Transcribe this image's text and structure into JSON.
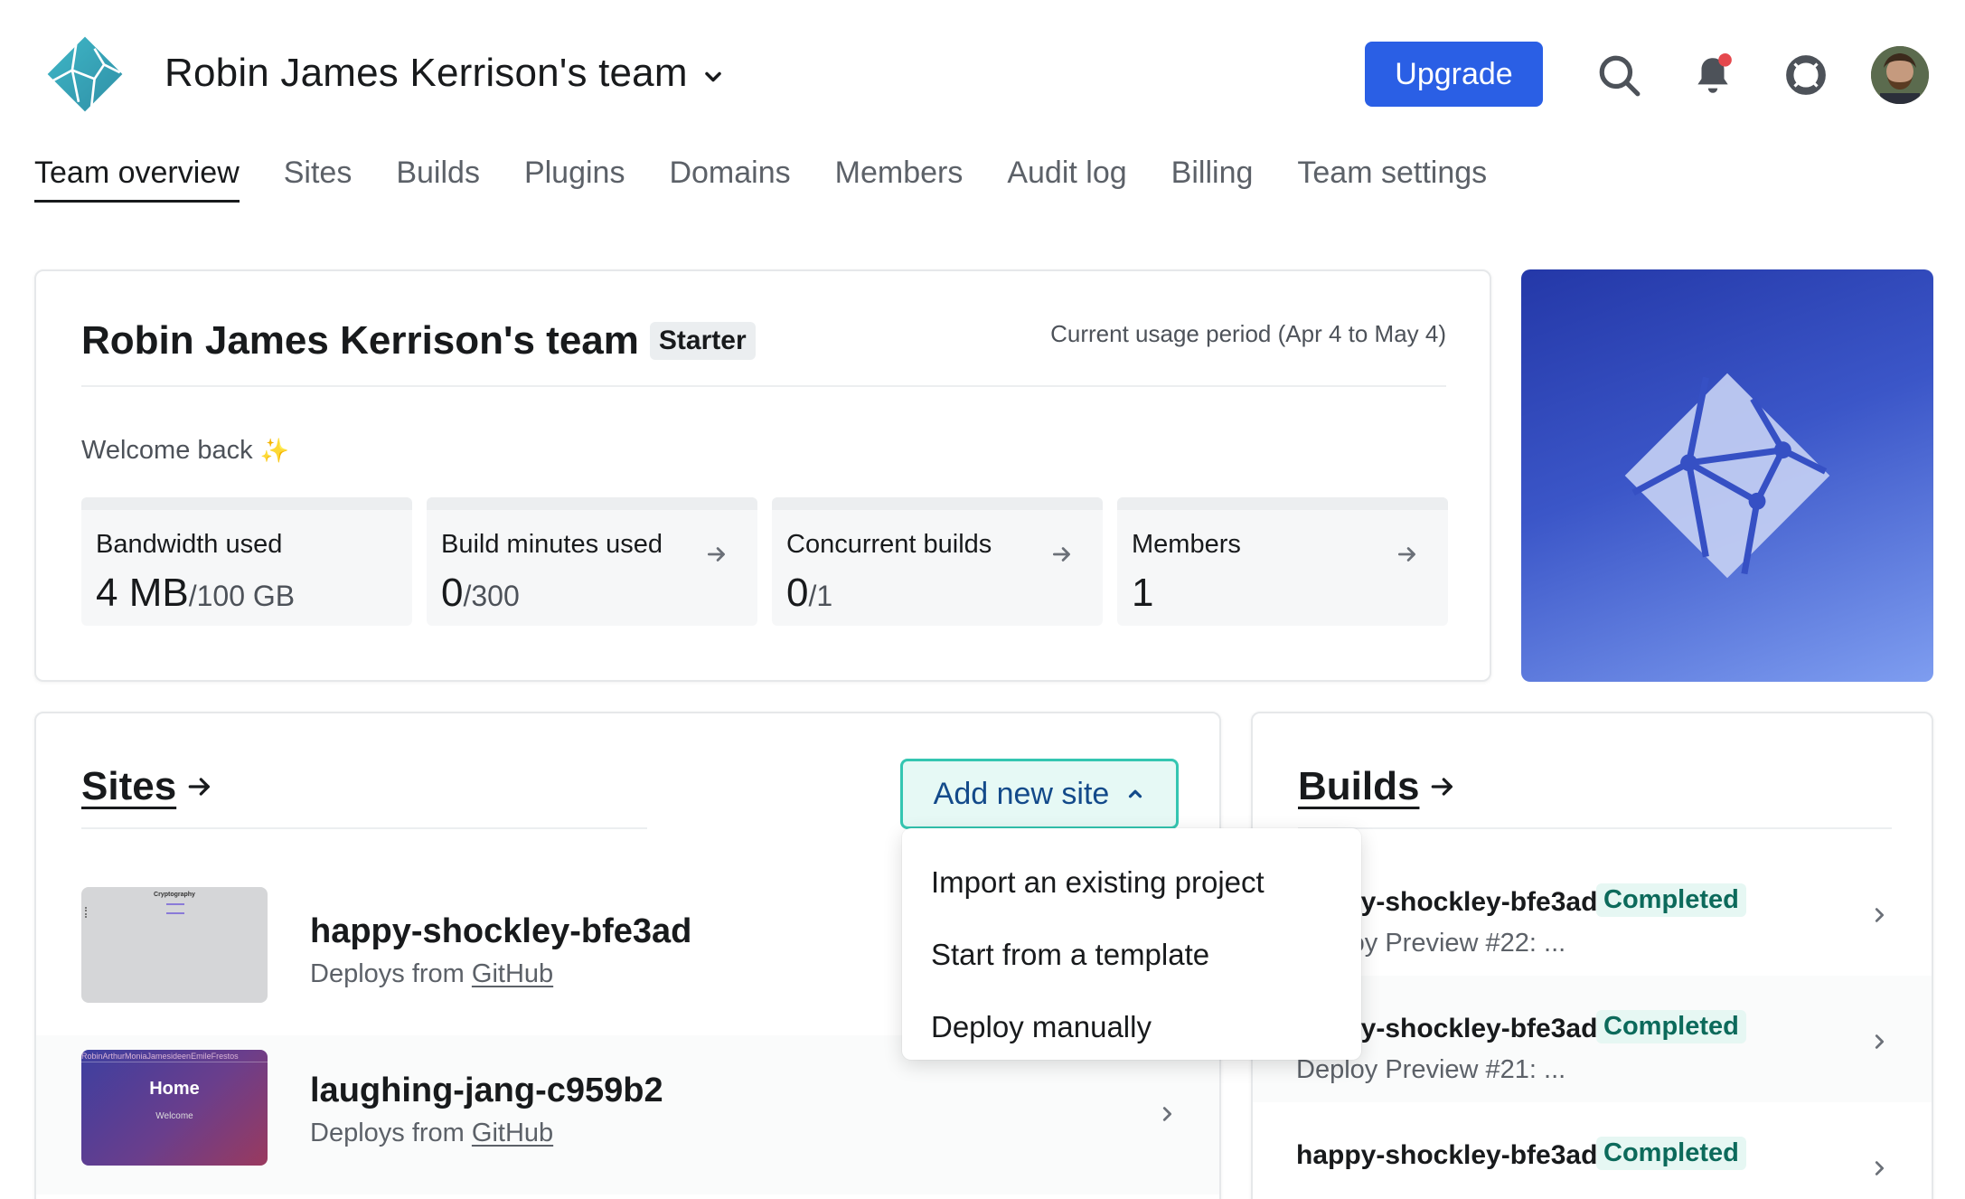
{
  "header": {
    "team_name": "Robin James Kerrison's team",
    "upgrade_label": "Upgrade",
    "icons": [
      "search-icon",
      "notifications-bell-icon",
      "help-lifebuoy-icon"
    ],
    "notification_dot_color": "#e5484d",
    "brand_color": "#2a5fe5"
  },
  "nav": {
    "items": [
      "Team overview",
      "Sites",
      "Builds",
      "Plugins",
      "Domains",
      "Members",
      "Audit log",
      "Billing",
      "Team settings"
    ],
    "active": "Team overview"
  },
  "overview": {
    "title": "Robin James Kerrison's team",
    "plan_badge": "Starter",
    "usage_period": "Current usage period (Apr 4 to May 4)",
    "welcome": "Welcome back",
    "welcome_icon": "sparkles-icon",
    "stats": [
      {
        "label": "Bandwidth used",
        "value": "4 MB",
        "limit": "/100 GB"
      },
      {
        "label": "Build minutes used",
        "value": "0",
        "limit": "/300"
      },
      {
        "label": "Concurrent builds",
        "value": "0",
        "limit": "/1"
      },
      {
        "label": "Members",
        "value": "1",
        "limit": ""
      }
    ]
  },
  "sites": {
    "title": "Sites",
    "add_button": "Add new site",
    "menu": [
      "Import an existing project",
      "Start from a template",
      "Deploy manually"
    ],
    "items": [
      {
        "name": "happy-shockley-bfe3ad",
        "deploy_prefix": "Deploys from",
        "provider": "GitHub",
        "thumb_title": "Cryptography"
      },
      {
        "name": "laughing-jang-c959b2",
        "deploy_prefix": "Deploys from",
        "provider": "GitHub",
        "thumb_nav": "RobinArthurMoniaJamesideenEmileFrestos",
        "thumb_title": "Home",
        "thumb_sub": "Welcome"
      }
    ]
  },
  "builds": {
    "title": "Builds",
    "items": [
      {
        "site": "happy-shockley-bfe3ad",
        "status": "Completed",
        "detail": "Deploy Preview #22: ..."
      },
      {
        "site": "happy-shockley-bfe3ad",
        "status": "Completed",
        "detail": "Deploy Preview #21: ..."
      },
      {
        "site": "happy-shockley-bfe3ad",
        "status": "Completed",
        "detail": ""
      }
    ]
  }
}
